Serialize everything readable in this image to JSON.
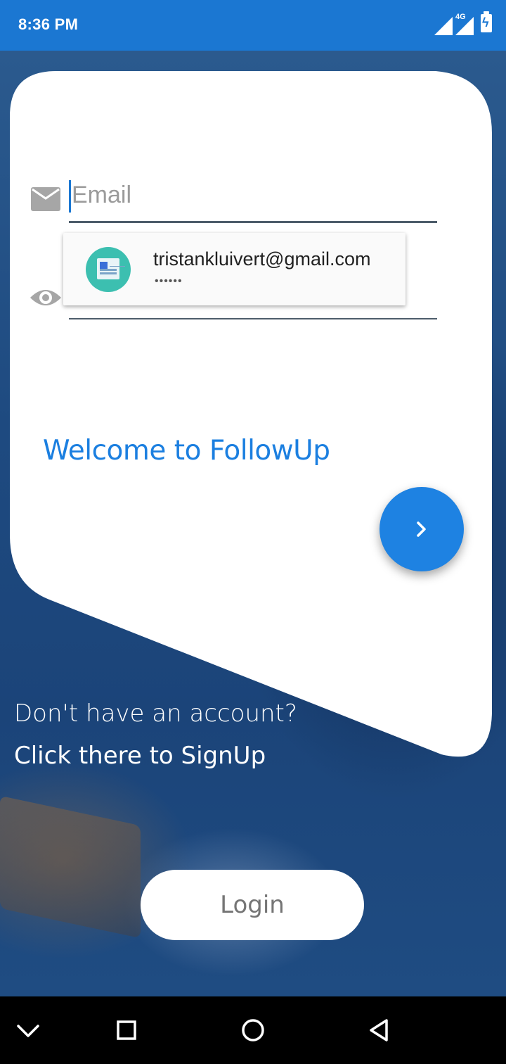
{
  "status_bar": {
    "time": "8:36 PM",
    "network_label": "4G",
    "icons": [
      "signal-icon",
      "signal-icon",
      "battery-charging-icon"
    ]
  },
  "login_form": {
    "email_placeholder": "Email",
    "email_value": "",
    "password_value": "",
    "icons": [
      "mail-icon",
      "eye-icon"
    ]
  },
  "autofill": {
    "account_email": "tristankluivert@gmail.com",
    "masked_password": "••••••",
    "icon": "account-card-icon"
  },
  "welcome_text": "Welcome to FollowUp",
  "next_button": {
    "icon": "chevron-right-icon"
  },
  "signup": {
    "question": "Don't have an account?",
    "link": "Click there to SignUp"
  },
  "login_button_label": "Login",
  "nav_bar": {
    "icons": [
      "chevron-down-icon",
      "recents-square-icon",
      "home-circle-icon",
      "back-triangle-icon"
    ]
  },
  "colors": {
    "status_bar": "#1b77d2",
    "accent": "#1e82e2",
    "card": "#ffffff",
    "background": "#1d4a7e"
  }
}
